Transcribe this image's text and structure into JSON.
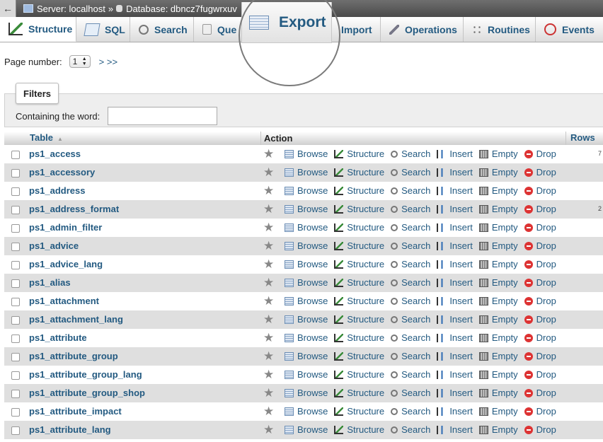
{
  "breadcrumb": {
    "back": "←",
    "server": "Server: localhost",
    "separator": "»",
    "database": "Database: dbncz7fugwrxuv"
  },
  "tabs": [
    {
      "label": "Structure",
      "icon": "structure-icon"
    },
    {
      "label": "SQL",
      "icon": "sql-icon"
    },
    {
      "label": "Search",
      "icon": "search-icon"
    },
    {
      "label": "Que",
      "icon": "query-icon"
    },
    {
      "label": "Import",
      "icon": "import-icon"
    },
    {
      "label": "Operations",
      "icon": "wrench-icon"
    },
    {
      "label": "Routines",
      "icon": "routines-icon"
    },
    {
      "label": "Events",
      "icon": "clock-icon"
    }
  ],
  "export_tab": {
    "label": "Export",
    "icon": "export-icon"
  },
  "pager": {
    "label": "Page number:",
    "value": "1",
    "more": "> >>"
  },
  "filters": {
    "legend": "Filters",
    "label": "Containing the word:",
    "value": ""
  },
  "table_header": {
    "table": "Table",
    "action": "Action",
    "rows": "Rows"
  },
  "actions": [
    "Browse",
    "Structure",
    "Search",
    "Insert",
    "Empty",
    "Drop"
  ],
  "rows": [
    {
      "name": "ps1_access",
      "count": "7"
    },
    {
      "name": "ps1_accessory",
      "count": ""
    },
    {
      "name": "ps1_address",
      "count": ""
    },
    {
      "name": "ps1_address_format",
      "count": "2"
    },
    {
      "name": "ps1_admin_filter",
      "count": ""
    },
    {
      "name": "ps1_advice",
      "count": ""
    },
    {
      "name": "ps1_advice_lang",
      "count": ""
    },
    {
      "name": "ps1_alias",
      "count": ""
    },
    {
      "name": "ps1_attachment",
      "count": ""
    },
    {
      "name": "ps1_attachment_lang",
      "count": ""
    },
    {
      "name": "ps1_attribute",
      "count": ""
    },
    {
      "name": "ps1_attribute_group",
      "count": ""
    },
    {
      "name": "ps1_attribute_group_lang",
      "count": ""
    },
    {
      "name": "ps1_attribute_group_shop",
      "count": ""
    },
    {
      "name": "ps1_attribute_impact",
      "count": ""
    },
    {
      "name": "ps1_attribute_lang",
      "count": ""
    }
  ]
}
